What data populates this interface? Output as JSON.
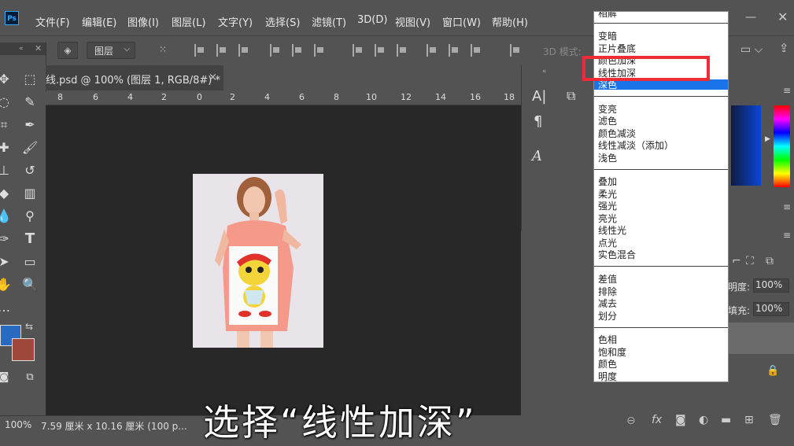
{
  "menubar": {
    "logo": "Ps",
    "items": [
      "文件(F)",
      "编辑(E)",
      "图像(I)",
      "图层(L)",
      "文字(Y)",
      "选择(S)",
      "滤镜(T)",
      "3D(D)",
      "视图(V)",
      "窗口(W)",
      "帮助(H)"
    ]
  },
  "options_bar": {
    "layer_select": "图层",
    "mode_3d": "3D 模式:"
  },
  "document": {
    "tab_title": "线.psd @ 100% (图层 1, RGB/8#) *",
    "close": "×",
    "ruler_labels": [
      "8",
      "6",
      "4",
      "2",
      "0",
      "2",
      "4",
      "6",
      "8",
      "10",
      "12",
      "14",
      "16",
      "18"
    ]
  },
  "status": {
    "zoom": "100%",
    "dims": "7.59 厘米 x 10.16 厘米 (100 p..."
  },
  "side_panel": {
    "char_icon": "A|",
    "para_icon": "¶",
    "glyph_icon": "A",
    "opacity_label": "明度:",
    "opacity_value": "100%",
    "fill_label": "填充:",
    "fill_value": "100%"
  },
  "colors": {
    "foreground": "#2a6bc2",
    "background": "#a0483b",
    "highlight": "#1a73e8",
    "red_box": "#ee2b37"
  },
  "blend_menu": {
    "partial_top": "相解",
    "group1": [
      "变暗",
      "正片叠底",
      "颜色加深",
      "线性加深",
      "深色"
    ],
    "group2": [
      "变亮",
      "滤色",
      "颜色减淡",
      "线性减淡（添加）",
      "浅色"
    ],
    "group3": [
      "叠加",
      "柔光",
      "强光",
      "亮光",
      "线性光",
      "点光",
      "实色混合"
    ],
    "group4": [
      "差值",
      "排除",
      "减去",
      "划分"
    ],
    "group5": [
      "色相",
      "饱和度",
      "颜色",
      "明度"
    ]
  },
  "caption": "选择“线性加深”"
}
